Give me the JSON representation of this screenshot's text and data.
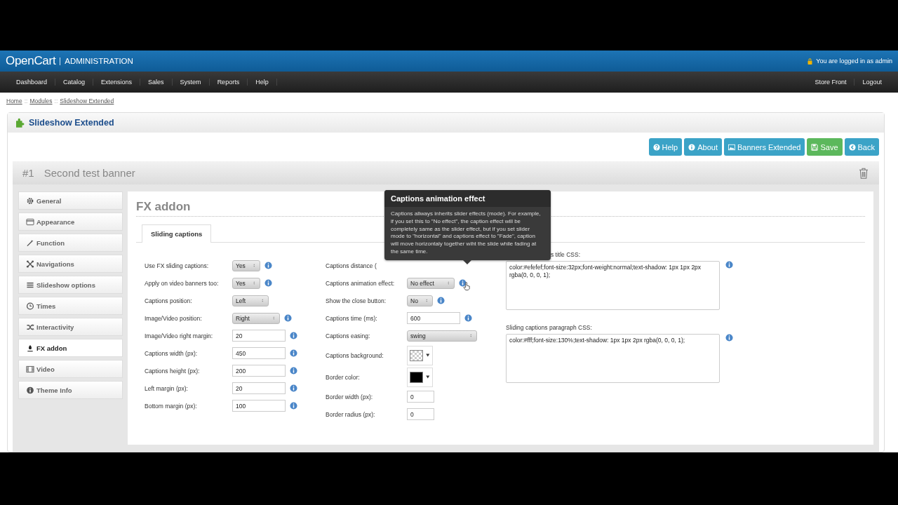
{
  "header": {
    "brand": "OpenCart",
    "section": "ADMINISTRATION",
    "login_text": "You are logged in as admin"
  },
  "menu": {
    "items": [
      "Dashboard",
      "Catalog",
      "Extensions",
      "Sales",
      "System",
      "Reports",
      "Help"
    ],
    "right_items": [
      "Store Front",
      "Logout"
    ]
  },
  "breadcrumb": [
    "Home",
    "Modules",
    "Slideshow Extended"
  ],
  "breadcrumb_separator": "::",
  "heading": {
    "title": "Slideshow Extended"
  },
  "buttons": [
    {
      "label": "Help",
      "kind": "info"
    },
    {
      "label": "About",
      "kind": "info"
    },
    {
      "label": "Banners Extended",
      "kind": "info"
    },
    {
      "label": "Save",
      "kind": "success"
    },
    {
      "label": "Back",
      "kind": "info"
    }
  ],
  "banner": {
    "number": "#1",
    "title": "Second test banner"
  },
  "sidebar": {
    "items": [
      {
        "label": "General",
        "selected": false
      },
      {
        "label": "Appearance",
        "selected": false
      },
      {
        "label": "Function",
        "selected": false
      },
      {
        "label": "Navigations",
        "selected": false
      },
      {
        "label": "Slideshow options",
        "selected": false
      },
      {
        "label": "Times",
        "selected": false
      },
      {
        "label": "Interactivity",
        "selected": false
      },
      {
        "label": "FX addon",
        "selected": true
      },
      {
        "label": "Video",
        "selected": false
      },
      {
        "label": "Theme Info",
        "selected": false
      }
    ]
  },
  "panel": {
    "title": "FX addon",
    "tabs": [
      {
        "label": "Sliding captions",
        "selected": true
      }
    ],
    "left_fields": [
      {
        "label": "Use FX sliding captions:",
        "kind": "select",
        "value": "Yes",
        "info": true
      },
      {
        "label": "Apply on video banners too:",
        "kind": "select",
        "value": "Yes",
        "info": true
      },
      {
        "label": "Captions position:",
        "kind": "select",
        "value": "Left",
        "info": false
      },
      {
        "label": "Image/Video position:",
        "kind": "select",
        "value": "Right",
        "info": true
      },
      {
        "label": "Image/Video right margin:",
        "kind": "text",
        "value": "20",
        "info": true
      },
      {
        "label": "Captions width (px):",
        "kind": "text",
        "value": "450",
        "info": true
      },
      {
        "label": "Captions height (px):",
        "kind": "text",
        "value": "200",
        "info": true
      },
      {
        "label": "Left margin (px):",
        "kind": "text",
        "value": "20",
        "info": true
      },
      {
        "label": "Bottom margin (px):",
        "kind": "text",
        "value": "100",
        "info": true
      }
    ],
    "middle_fields": [
      {
        "label": "Captions distance (",
        "kind": "hidden",
        "info": false
      },
      {
        "label": "Captions animation effect:",
        "kind": "select",
        "value": "No effect",
        "info": true
      },
      {
        "label": "Show the close button:",
        "kind": "select",
        "value": "No",
        "info": true
      },
      {
        "label": "Captions time (ms):",
        "kind": "text",
        "value": "600",
        "info": true
      },
      {
        "label": "Captions easing:",
        "kind": "wideselect",
        "value": "swing",
        "info": false
      },
      {
        "label": "Captions background:",
        "kind": "color",
        "transparent": true,
        "info": false
      },
      {
        "label": "Border color:",
        "kind": "color",
        "transparent": false,
        "color": "#000000",
        "info": false
      },
      {
        "label": "Border width (px):",
        "kind": "small",
        "value": "0",
        "info": false
      },
      {
        "label": "Border radius (px):",
        "kind": "small",
        "value": "0",
        "info": false
      }
    ],
    "css_fields": [
      {
        "label": "s title CSS:",
        "label_covered": true,
        "value": "color:#efefef;font-size:32px;font-weight:normal;text-shadow: 1px 1px 2px rgba(0, 0, 0, 1);"
      },
      {
        "label": "Sliding captions paragraph CSS:",
        "label_covered": false,
        "value": "color:#fff;font-size:130%;text-shadow: 1px 1px 2px rgba(0, 0, 0, 1);"
      }
    ],
    "tooltip": {
      "title": "Captions animation effect",
      "text": "Captions allways inherits slider effects (mode). For example, if you set this to \"No effect\", the caption effect will be completely same as the slider effect, but if you set slider mode to \"horizontal\" and captions effect to \"Fade\", caption will move horizontaly together wiht the slide while fading at the same time."
    }
  }
}
